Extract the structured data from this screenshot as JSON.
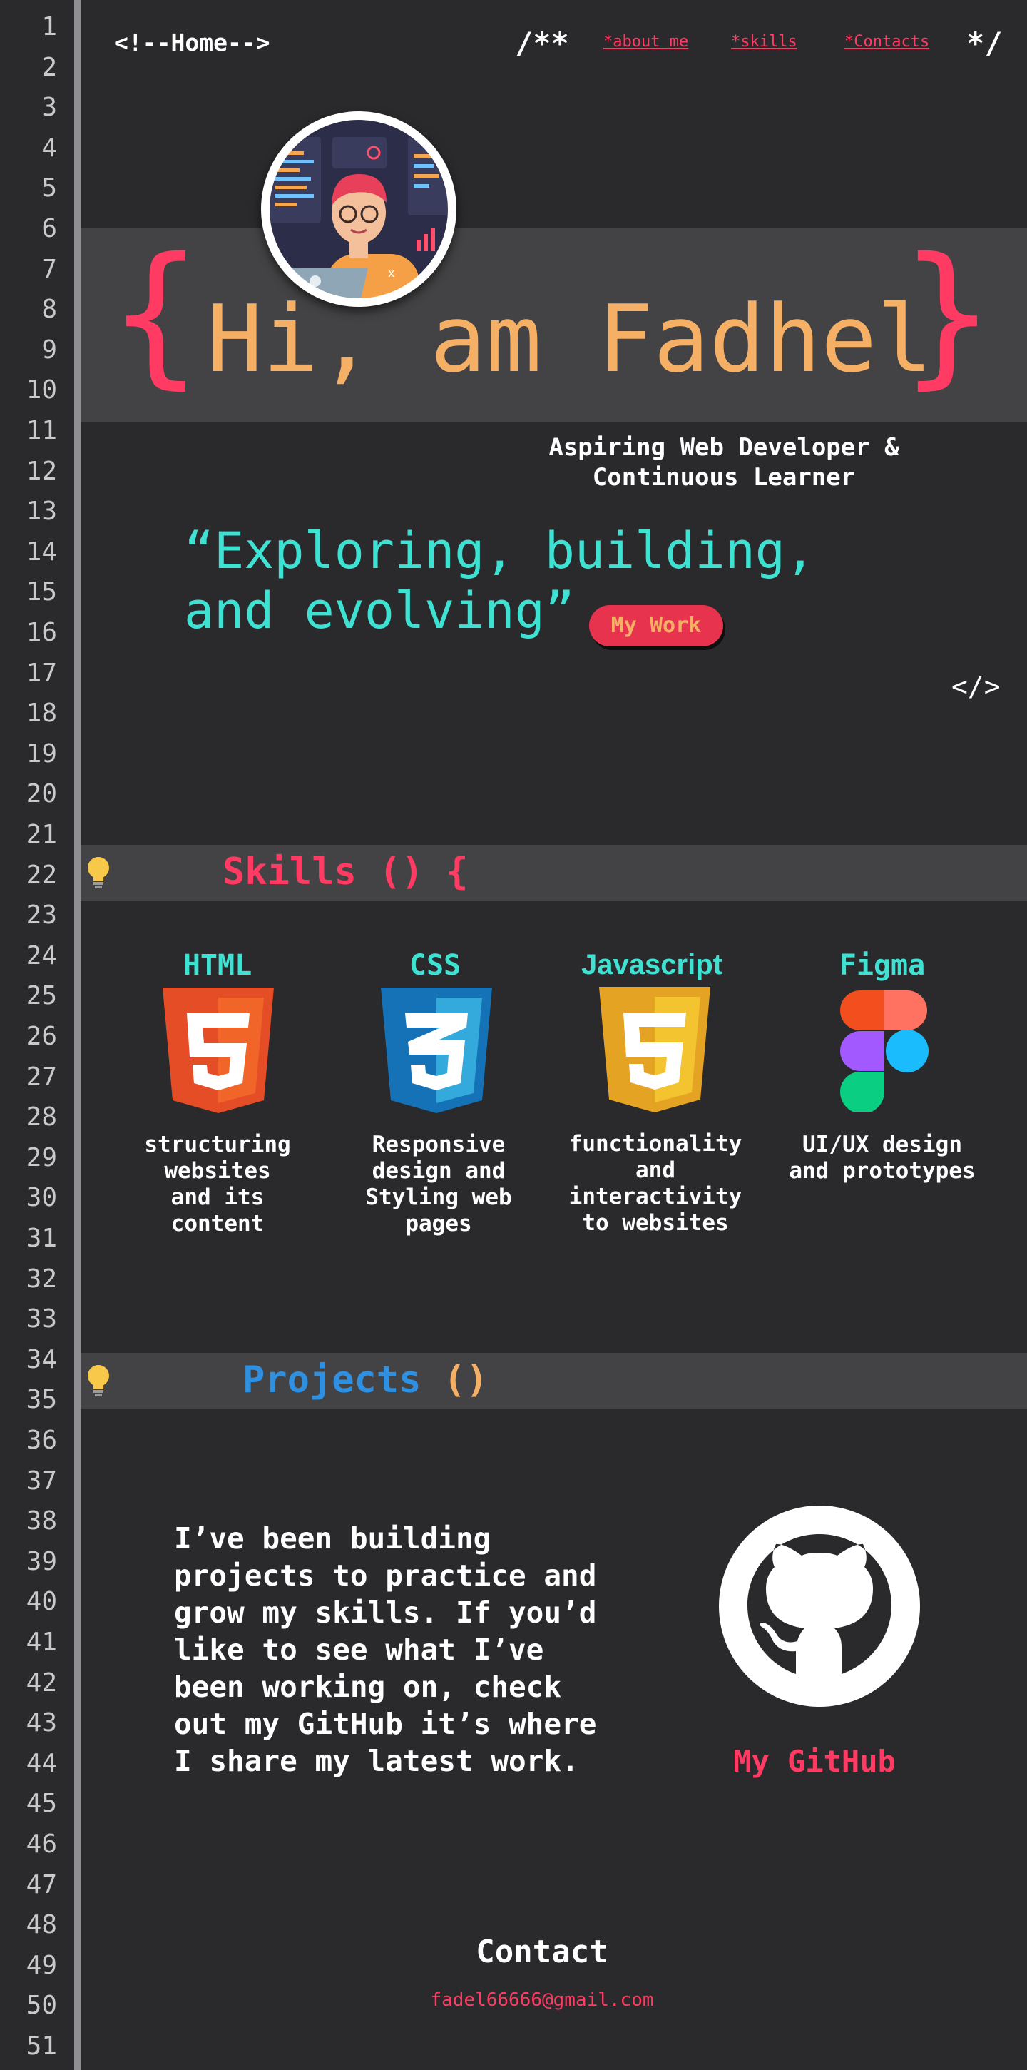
{
  "gutter": {
    "line_numbers": [
      "1",
      "2",
      "3",
      "4",
      "5",
      "6",
      "7",
      "8",
      "9",
      "10",
      "11",
      "12",
      "13",
      "14",
      "15",
      "16",
      "17",
      "18",
      "19",
      "20",
      "21",
      "22",
      "23",
      "24",
      "25",
      "26",
      "27",
      "28",
      "29",
      "30",
      "31",
      "32",
      "33",
      "34",
      "35",
      "36",
      "37",
      "38",
      "39",
      "40",
      "41",
      "42",
      "43",
      "44",
      "45",
      "46",
      "47",
      "48",
      "49",
      "50",
      "51"
    ]
  },
  "nav": {
    "home": "<!--Home-->",
    "open_comment": "/**",
    "about": "*about me",
    "skills": "*skills",
    "contacts": "*Contacts",
    "close_comment": "*/"
  },
  "hero": {
    "brace_open": "{",
    "title": "Hi, am Fadhel",
    "brace_close": "}",
    "subtitle_line1": "Aspiring Web Developer &",
    "subtitle_line2": "Continuous Learner",
    "quote_line1": "“Exploring, building,",
    "quote_line2": "and evolving”",
    "cta": "My Work",
    "close_tag": "</>"
  },
  "skills": {
    "heading": "Skills",
    "parens": "() {",
    "items": [
      {
        "title": "HTML",
        "desc": [
          "structuring",
          "websites",
          "and its",
          "content"
        ],
        "icon": "html5-icon"
      },
      {
        "title": "CSS",
        "desc": [
          "Responsive",
          "design and",
          "Styling web",
          "pages"
        ],
        "icon": "css3-icon"
      },
      {
        "title": "Javascript",
        "desc": [
          "functionality",
          "and",
          "interactivity",
          "to websites"
        ],
        "icon": "javascript-icon"
      },
      {
        "title": "Figma",
        "desc": [
          "UI/UX design",
          "and prototypes"
        ],
        "icon": "figma-icon"
      }
    ]
  },
  "projects": {
    "heading": "Projects",
    "parens": "()",
    "text_lines": [
      "I’ve been building",
      "projects to practice and",
      "grow my skills. If you’d",
      "like to see what I’ve",
      "been working on, check",
      "out my GitHub it’s where",
      "I share my latest work."
    ],
    "github_label": "My GitHub"
  },
  "contact": {
    "heading": "Contact",
    "email": "fadel66666@gmail.com"
  },
  "colors": {
    "background": "#2a2a2d",
    "band": "#434345",
    "accent_red": "#ff3b63",
    "accent_orange": "#f6b066",
    "accent_teal": "#3ee2d3",
    "accent_blue": "#2f8fe0"
  }
}
